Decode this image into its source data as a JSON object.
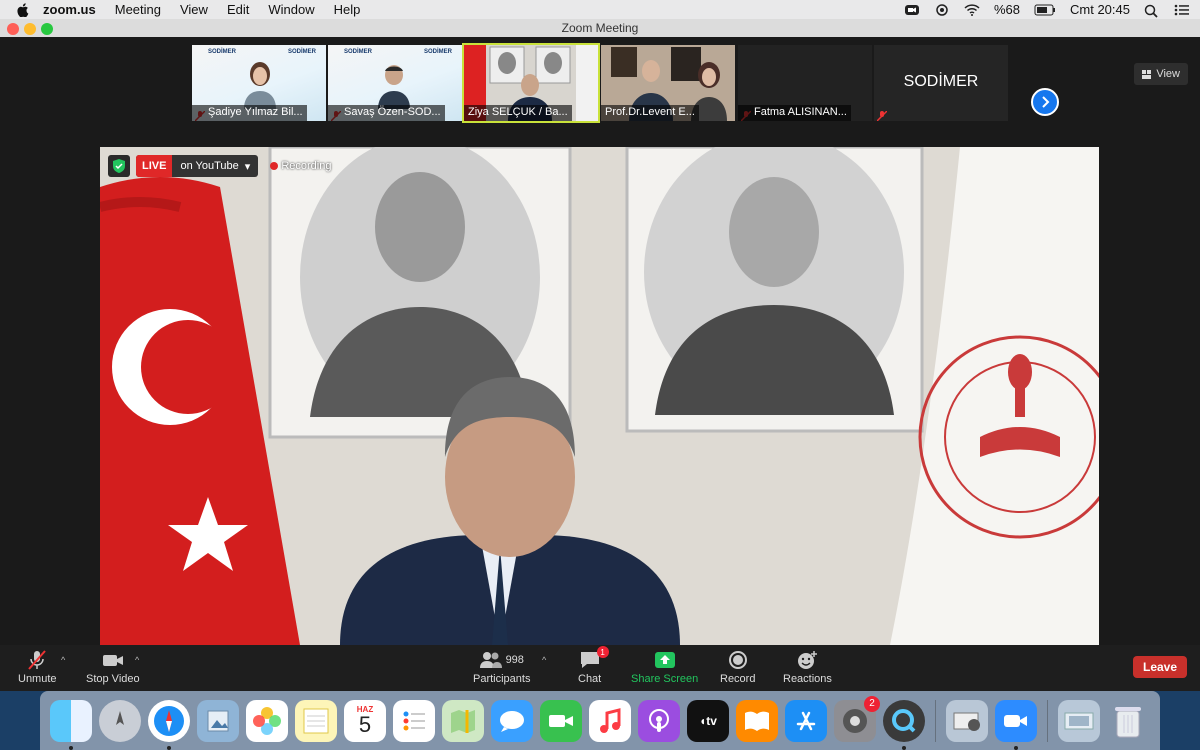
{
  "menubar": {
    "app_name": "zoom.us",
    "items": [
      "Meeting",
      "View",
      "Edit",
      "Window",
      "Help"
    ],
    "battery": "%68",
    "clock": "Cmt 20:45"
  },
  "window": {
    "title": "Zoom Meeting",
    "view_label": "View"
  },
  "thumbnails": [
    {
      "name": "Şadiye Yılmaz Bil...",
      "muted": true
    },
    {
      "name": "Savaş Özen-SOD...",
      "muted": true
    },
    {
      "name": "Ziya SELÇUK / Ba...",
      "muted": false,
      "active": true
    },
    {
      "name": "Prof.Dr.Levent E...",
      "muted": false
    },
    {
      "name": "Fatma ALISINAN...",
      "muted": true
    },
    {
      "name": "SODİMER",
      "muted": true
    }
  ],
  "sodimer_text": "SODİMER",
  "main_video": {
    "live_badge": "LIVE",
    "stream_label": "on YouTube",
    "recording_label": "Recording"
  },
  "toolbar": {
    "unmute": "Unmute",
    "stop_video": "Stop Video",
    "participants": "Participants",
    "participant_count": "998",
    "chat": "Chat",
    "chat_badge": "1",
    "share_screen": "Share Screen",
    "record": "Record",
    "reactions": "Reactions",
    "leave": "Leave"
  },
  "dock": {
    "calendar_month": "HAZ",
    "calendar_day": "5",
    "system_prefs_badge": "2",
    "apps": [
      "finder-icon",
      "launchpad-icon",
      "safari-icon",
      "preview-icon",
      "photos-icon",
      "notes-icon",
      "calendar-icon",
      "reminders-icon",
      "maps-icon",
      "messages-icon",
      "facetime-icon",
      "music-icon",
      "podcasts-icon",
      "tv-icon",
      "books-icon",
      "app-store-icon",
      "system-preferences-icon",
      "quicktime-icon",
      "image-capture-icon",
      "zoom-icon",
      "downloads-icon",
      "trash-icon"
    ]
  },
  "colors": {
    "live_red": "#e02828",
    "leave_red": "#c8302b",
    "share_green": "#22c55e",
    "active_outline": "#c9e23a",
    "zoom_blue": "#1677ee"
  }
}
